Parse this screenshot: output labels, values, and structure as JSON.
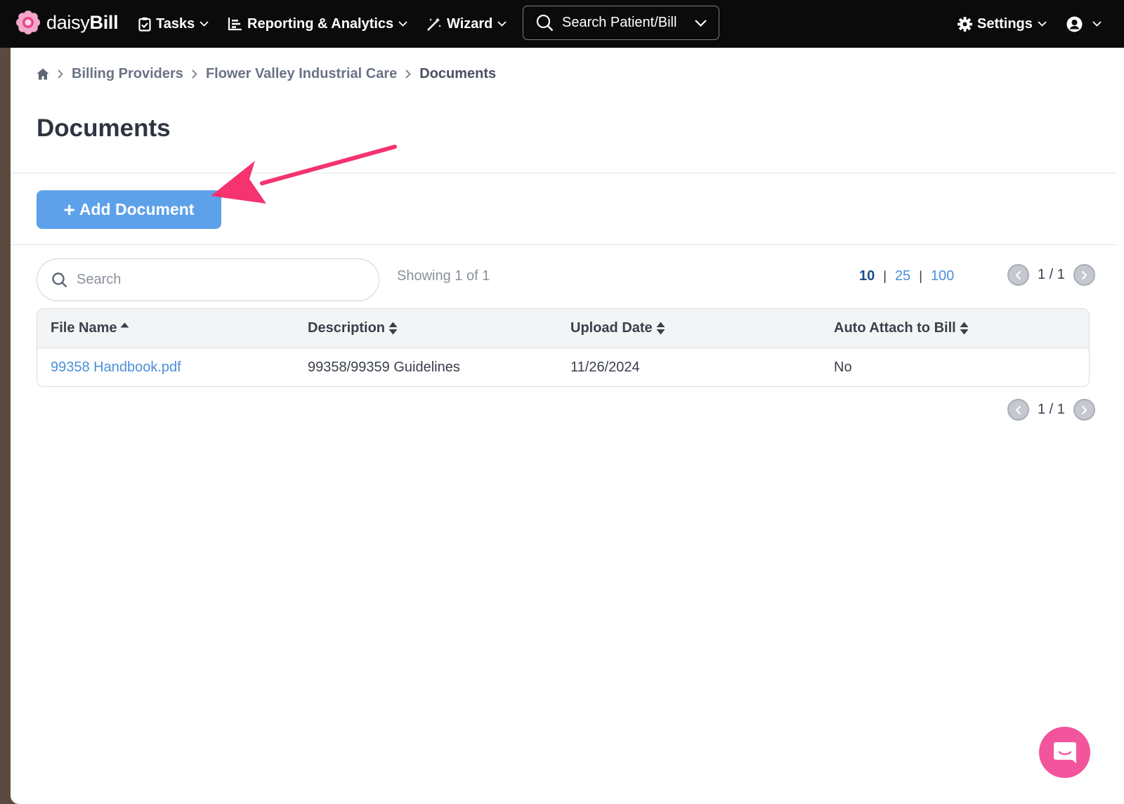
{
  "topbar": {
    "logo_text_light": "daisy",
    "logo_text_bold": "Bill",
    "tasks_label": "Tasks",
    "reporting_label": "Reporting & Analytics",
    "wizard_label": "Wizard",
    "search_label": "Search Patient/Bill",
    "settings_label": "Settings"
  },
  "breadcrumb": {
    "items": [
      "Billing Providers",
      "Flower Valley Industrial Care"
    ],
    "current": "Documents"
  },
  "page": {
    "title": "Documents",
    "add_button_label": "Add Document"
  },
  "list": {
    "search_placeholder": "Search",
    "showing_text": "Showing 1 of 1",
    "page_sizes": [
      "10",
      "25",
      "100"
    ],
    "active_page_size": "10",
    "pager_text": "1 / 1"
  },
  "table": {
    "headers": [
      "File Name",
      "Description",
      "Upload Date",
      "Auto Attach to Bill"
    ],
    "rows": [
      {
        "file_name": "99358 Handbook.pdf",
        "description": "99358/99359 Guidelines",
        "upload_date": "11/26/2024",
        "auto_attach": "No"
      }
    ]
  },
  "colors": {
    "topbar": "#0b0b0b",
    "primary_button": "#5da1ea",
    "link": "#4a8fdc",
    "annotation_arrow": "#f4336f",
    "chat_button": "#f2559c"
  },
  "icons": [
    "daisy-logo-icon",
    "clipboard-check-icon",
    "chart-bar-icon",
    "magic-wand-icon",
    "search-icon",
    "chevron-down-icon",
    "gear-icon",
    "user-circle-icon",
    "home-icon",
    "chevron-right-icon",
    "sort-icon",
    "chevron-left-icon",
    "chat-icon"
  ]
}
